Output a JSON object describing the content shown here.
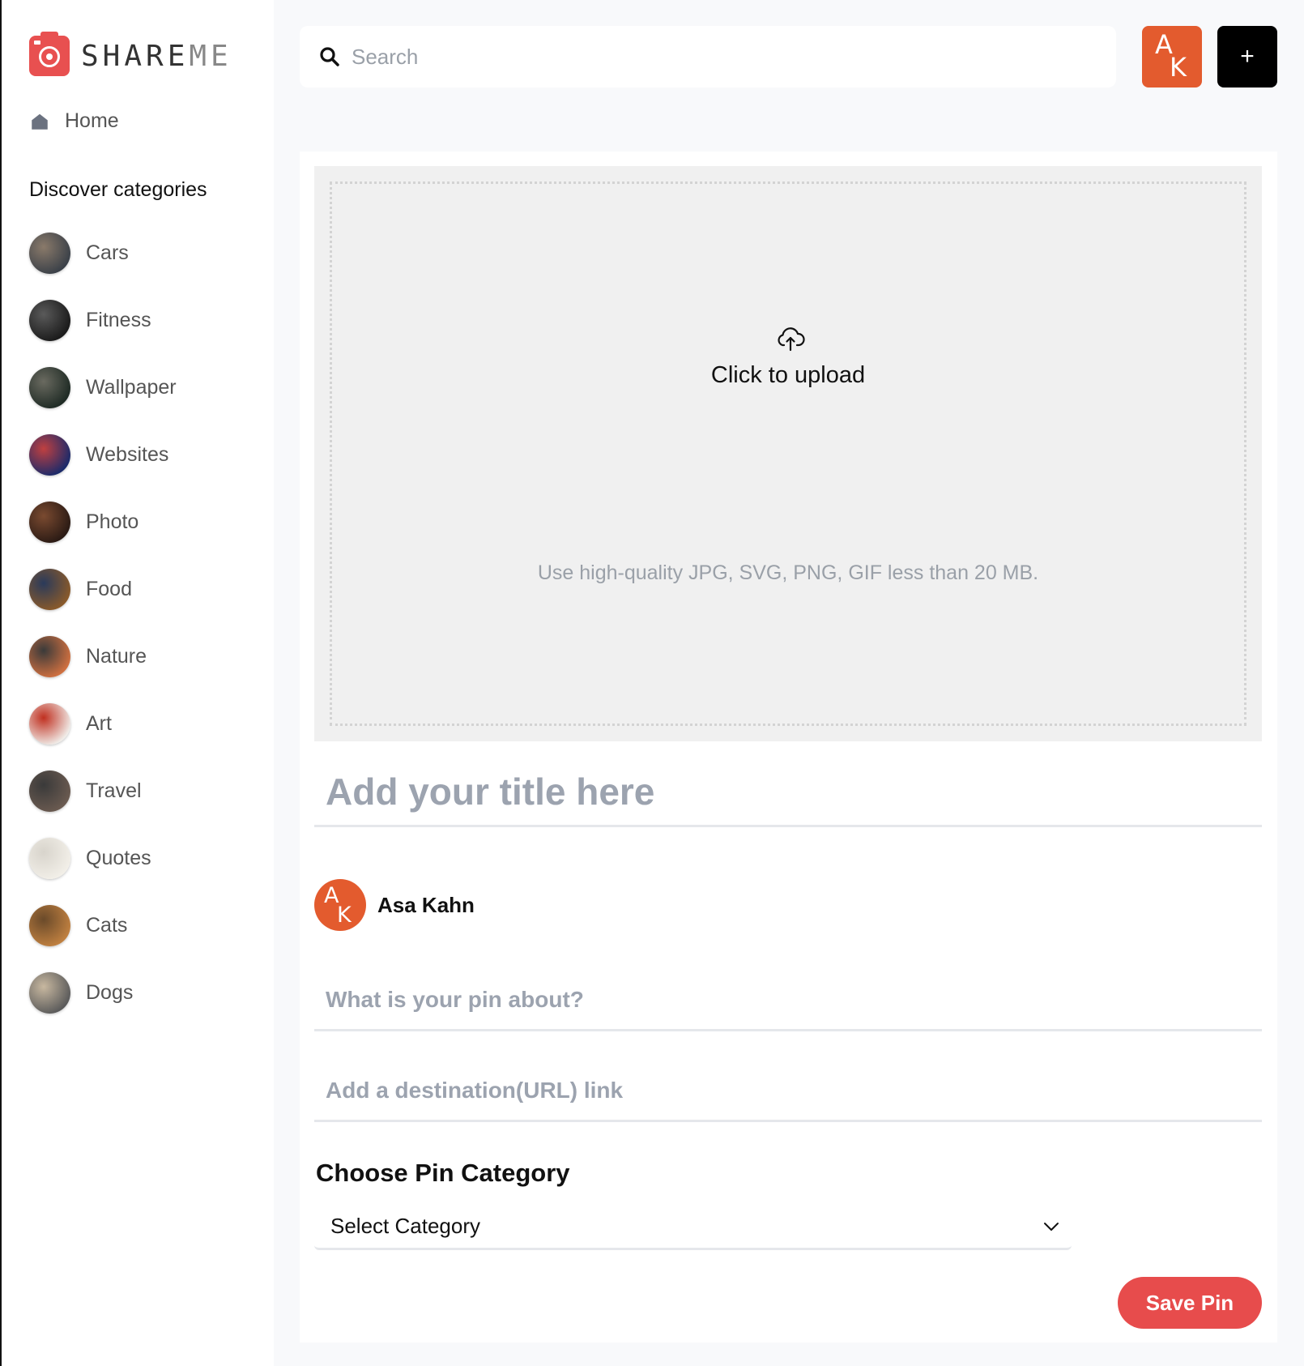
{
  "app": {
    "logo_text_bold": "SHARE",
    "logo_text_light": "ME"
  },
  "sidebar": {
    "home_label": "Home",
    "discover_heading": "Discover categories",
    "categories": [
      {
        "label": "Cars",
        "thumb_colors": [
          "#3a4048",
          "#8a7a6a"
        ]
      },
      {
        "label": "Fitness",
        "thumb_colors": [
          "#1a1a1a",
          "#5a5a5a"
        ]
      },
      {
        "label": "Wallpaper",
        "thumb_colors": [
          "#1e2a24",
          "#6a6a60"
        ]
      },
      {
        "label": "Websites",
        "thumb_colors": [
          "#1a2a6a",
          "#c04040"
        ]
      },
      {
        "label": "Photo",
        "thumb_colors": [
          "#2a1a14",
          "#7a4a30"
        ]
      },
      {
        "label": "Food",
        "thumb_colors": [
          "#8a5a2a",
          "#2a3a5a"
        ]
      },
      {
        "label": "Nature",
        "thumb_colors": [
          "#d07040",
          "#3a3a3a"
        ]
      },
      {
        "label": "Art",
        "thumb_colors": [
          "#f0ece8",
          "#c03020"
        ]
      },
      {
        "label": "Travel",
        "thumb_colors": [
          "#6a5a50",
          "#3a3a3a"
        ]
      },
      {
        "label": "Quotes",
        "thumb_colors": [
          "#f2efe8",
          "#d8d4cc"
        ]
      },
      {
        "label": "Cats",
        "thumb_colors": [
          "#c08040",
          "#6a4a2a"
        ]
      },
      {
        "label": "Dogs",
        "thumb_colors": [
          "#5a5a5a",
          "#c8b8a0"
        ]
      }
    ]
  },
  "topbar": {
    "search_placeholder": "Search",
    "avatar_initials_top": "A",
    "avatar_initials_bottom": "K",
    "add_button_label": "+"
  },
  "form": {
    "upload_label": "Click to upload",
    "upload_hint": "Use high-quality JPG, SVG, PNG, GIF less than 20 MB.",
    "title_placeholder": "Add your title here",
    "author_name": "Asa Kahn",
    "about_placeholder": "What is your pin about?",
    "destination_placeholder": "Add a destination(URL) link",
    "category_heading": "Choose Pin Category",
    "category_select_value": "Select Category",
    "save_button_label": "Save Pin"
  },
  "colors": {
    "brand_red": "#e74c4c",
    "avatar_orange": "#e35b2e",
    "page_bg": "#f8f9fb"
  }
}
